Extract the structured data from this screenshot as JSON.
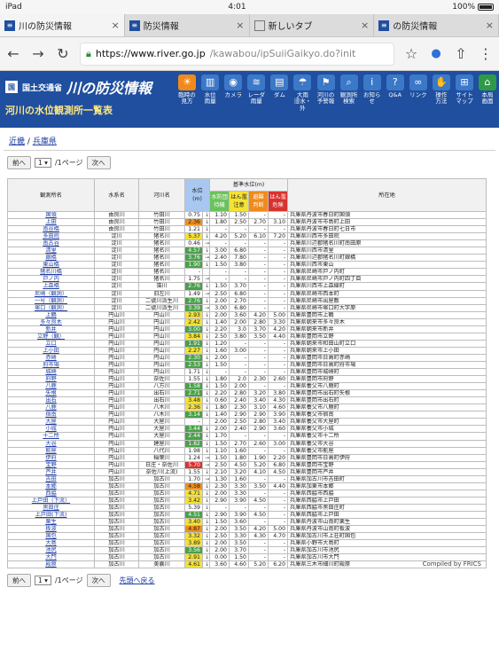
{
  "status_bar": {
    "device": "iPad",
    "time": "4:01",
    "battery": "100%"
  },
  "tabs": [
    {
      "title": "川の防災情報",
      "icon": "mlit-icon",
      "active": true
    },
    {
      "title": "防災情報",
      "icon": "mlit-icon",
      "active": false
    },
    {
      "title": "新しいタブ",
      "icon": "blank-page-icon",
      "active": false
    },
    {
      "title": "の防災情報",
      "icon": "mlit-icon",
      "active": false
    }
  ],
  "omnibox": {
    "host": "https://www.river.go.jp",
    "path": "/kawabou/ipSuiiGaikyo.do?init"
  },
  "site": {
    "agency": "国土交通省",
    "title": "川の防災情報",
    "subtitle": "河川の水位観測所一覧表",
    "nav": [
      {
        "label": "臨時の\n見方",
        "icon": "sun-icon"
      },
      {
        "label": "水位\n雨量",
        "icon": "gauge-icon"
      },
      {
        "label": "カメラ",
        "icon": "camera-icon"
      },
      {
        "label": "レーダ\n雨量",
        "icon": "radar-icon"
      },
      {
        "label": "ダム",
        "icon": "dam-icon"
      },
      {
        "label": "大雨\n浸水・\n外",
        "icon": "flood-icon"
      },
      {
        "label": "河川の\n予警報",
        "icon": "warning-icon"
      },
      {
        "label": "観測所\n検索",
        "icon": "search-icon"
      },
      {
        "label": "お知ら\nせ",
        "icon": "info-icon"
      },
      {
        "label": "Q&A",
        "icon": "question-icon"
      },
      {
        "label": "リンク",
        "icon": "link-icon"
      },
      {
        "label": "操作\n方法",
        "icon": "operation-icon"
      },
      {
        "label": "サイト\nマップ",
        "icon": "sitemap-icon"
      },
      {
        "label": "本局\n画面",
        "icon": "home-icon"
      }
    ]
  },
  "breadcrumb": {
    "region": "近畿",
    "sep": "/",
    "pref": "兵庫県"
  },
  "pager": {
    "prev": "前へ",
    "page": "1",
    "of": "/1ページ",
    "next": "次へ"
  },
  "back_link": "先頭へ戻る",
  "compiled": "Compiled by FRICS",
  "table": {
    "headers": {
      "station": "観測所名",
      "system": "水系名",
      "river": "河川名",
      "level": "水位\n(m)",
      "criteria": "基準水位(m)",
      "lv1": "水防団\n待機",
      "lv2": "はん濫\n注意",
      "lv3": "避難\n判断",
      "lv4": "はん濫\n危険",
      "location": "所在地"
    },
    "rows": [
      {
        "n": "国領",
        "s": "由良川",
        "r": "竹田川",
        "v": "0.75",
        "a": "↓",
        "c": "",
        "l1": "1.10",
        "l2": "1.50",
        "l3": "-",
        "l4": "-",
        "loc": "兵庫県丹波市春日町国領"
      },
      {
        "n": "上田",
        "s": "由良川",
        "r": "竹田川",
        "v": "2.36",
        "a": "↓",
        "c": "o",
        "l1": "1.80",
        "l2": "2.50",
        "l3": "2.70",
        "l4": "3.10",
        "loc": "兵庫県丹波市市島町上田"
      },
      {
        "n": "南谷橋",
        "s": "由良川",
        "r": "竹田川",
        "v": "1.21",
        "a": "↓",
        "c": "",
        "l1": "-",
        "l2": "-",
        "l3": "-",
        "l4": "-",
        "loc": "兵庫県丹波市春日町七日市"
      },
      {
        "n": "多田院",
        "s": "淀川",
        "r": "猪名川",
        "v": "5.37",
        "a": "↓",
        "c": "y",
        "l1": "4.20",
        "l2": "5.20",
        "l3": "6.10",
        "l4": "7.20",
        "loc": "兵庫県川西市多田院"
      },
      {
        "n": "南古谷",
        "s": "淀川",
        "r": "猪名川",
        "v": "0.46",
        "a": "→",
        "c": "",
        "l1": "-",
        "l2": "-",
        "l3": "-",
        "l4": "-",
        "loc": "兵庫県川辺郡猪名川町南田原"
      },
      {
        "n": "清里",
        "s": "淀川",
        "r": "猪名川",
        "v": "4.57",
        "a": "↓",
        "c": "g",
        "l1": "3.00",
        "l2": "6.80",
        "l3": "-",
        "l4": "-",
        "loc": "兵庫県川西市清里"
      },
      {
        "n": "銀橋",
        "s": "淀川",
        "r": "猪名川",
        "v": "3.76",
        "a": "→",
        "c": "g",
        "l1": "2.40",
        "l2": "7.80",
        "l3": "-",
        "l4": "-",
        "loc": "兵庫県川辺郡猪名川町銀橋"
      },
      {
        "name_only": true,
        "n": "東山橋",
        "s": "淀川",
        "r": "猪名川",
        "v": "1.90",
        "a": "↓",
        "c": "g",
        "l1": "1.50",
        "l2": "3.80",
        "l3": "-",
        "l4": "-",
        "loc": "兵庫県川西市東山"
      },
      {
        "n": "猪名川橋",
        "s": "淀川",
        "r": "猪名川",
        "v": "-",
        "a": "",
        "c": "",
        "l1": "-",
        "l2": "-",
        "l3": "-",
        "l4": "-",
        "loc": "兵庫県尼崎市戸ノ内町"
      },
      {
        "n": "戸ノ内",
        "s": "淀川",
        "r": "猪名川",
        "v": "1.75",
        "a": "→",
        "c": "",
        "l1": "-",
        "l2": "-",
        "l3": "-",
        "l4": "-",
        "loc": "兵庫県尼崎市戸ノ内町四丁目"
      },
      {
        "n": "上森橋",
        "s": "淀川",
        "r": "藻川",
        "v": "2.76",
        "a": "↓",
        "c": "g",
        "l1": "1.50",
        "l2": "3.70",
        "l3": "-",
        "l4": "-",
        "loc": "兵庫県川西市上森線町"
      },
      {
        "n": "尼崎（観測）",
        "s": "淀川",
        "r": "旧左川",
        "v": "1.49",
        "a": "→",
        "c": "",
        "l1": "2.50",
        "l2": "6.80",
        "l3": "-",
        "l4": "-",
        "loc": "兵庫県尼崎市西本町"
      },
      {
        "n": "一号（観測）",
        "s": "淀川",
        "r": "二號川派生川",
        "v": "2.76",
        "a": "↓",
        "c": "g",
        "l1": "2.00",
        "l2": "2.70",
        "l3": "-",
        "l4": "-",
        "loc": "兵庫県尼崎市出屋敷"
      },
      {
        "n": "塚口（観測）",
        "s": "淀川",
        "r": "二號川派生川",
        "v": "3.39",
        "a": "→",
        "c": "g",
        "l1": "3.00",
        "l2": "6.80",
        "l3": "-",
        "l4": "-",
        "loc": "兵庫県尼崎市塚口町大字原"
      },
      {
        "n": "上鶴",
        "s": "円山川",
        "r": "円山川",
        "v": "2.93",
        "a": "↓",
        "c": "y",
        "l1": "2.00",
        "l2": "3.60",
        "l3": "4.20",
        "l4": "5.00",
        "loc": "兵庫県豊岡市上鶴"
      },
      {
        "n": "多々良木",
        "s": "円山川",
        "r": "円山川",
        "v": "2.42",
        "a": "↓",
        "c": "y",
        "l1": "1.40",
        "l2": "2.00",
        "l3": "2.80",
        "l4": "3.30",
        "loc": "兵庫県朝来市多々良木"
      },
      {
        "n": "新井",
        "s": "円山川",
        "r": "円山川",
        "v": "3.00",
        "a": "↓",
        "c": "g",
        "l1": "2.20",
        "l2": "3.0",
        "l3": "3.70",
        "l4": "4.20",
        "loc": "兵庫県朝来市新井"
      },
      {
        "n": "立野（観）",
        "s": "円山川",
        "r": "円山川",
        "v": "3.84",
        "a": "↓",
        "c": "y",
        "l1": "2.50",
        "l2": "3.80",
        "l3": "3.50",
        "l4": "4.40",
        "loc": "兵庫県豊岡市立野"
      },
      {
        "n": "立口",
        "s": "円山川",
        "r": "円山川",
        "v": "1.91",
        "a": "↓",
        "c": "g",
        "l1": "1.20",
        "l2": "-",
        "l3": "-",
        "l4": "-",
        "loc": "兵庫県朝来市和田山町立口"
      },
      {
        "n": "上小田",
        "s": "円山川",
        "r": "円山川",
        "v": "2.27",
        "a": "↓",
        "c": "y",
        "l1": "1.60",
        "l2": "3.00",
        "l3": "-",
        "l4": "-",
        "loc": "兵庫県朝来市上小田"
      },
      {
        "n": "赤崎",
        "s": "円山川",
        "r": "円山川",
        "v": "2.30",
        "a": "↓",
        "c": "g",
        "l1": "2.00",
        "l2": "-",
        "l3": "-",
        "l4": "-",
        "loc": "兵庫県豊岡市日高町赤崎"
      },
      {
        "n": "府市場",
        "s": "円山川",
        "r": "円山川",
        "v": "2.53",
        "a": "↓",
        "c": "g",
        "l1": "1.50",
        "l2": "-",
        "l3": "-",
        "l4": "-",
        "loc": "兵庫県豊岡市日高町府市場"
      },
      {
        "n": "城崎",
        "s": "円山川",
        "r": "円山川",
        "v": "1.71",
        "a": "↓",
        "c": "",
        "l1": "-",
        "l2": "-",
        "l3": "-",
        "l4": "-",
        "loc": "兵庫県豊岡市城崎町"
      },
      {
        "n": "府野",
        "s": "円山川",
        "r": "奈佐川",
        "v": "1.55",
        "a": "↓",
        "c": "",
        "l1": "1.80",
        "l2": "2.0",
        "l3": "2.30",
        "l4": "2.60",
        "loc": "兵庫県豊岡市府野"
      },
      {
        "n": "八鹿",
        "s": "円山川",
        "r": "八方川",
        "v": "1.58",
        "a": "↓",
        "c": "g",
        "l1": "1.50",
        "l2": "2.00",
        "l3": "-",
        "l4": "-",
        "loc": "兵庫県養父市八鹿町"
      },
      {
        "n": "矢根",
        "s": "円山川",
        "r": "出石川",
        "v": "2.71",
        "a": "↓",
        "c": "g",
        "l1": "2.20",
        "l2": "2.80",
        "l3": "3.20",
        "l4": "3.80",
        "loc": "兵庫県豊岡市出石町矢根"
      },
      {
        "n": "出石",
        "s": "円山川",
        "r": "出石川",
        "v": "3.48",
        "a": "↓",
        "c": "y",
        "l1": "0.60",
        "l2": "2.40",
        "l3": "3.40",
        "l4": "4.30",
        "loc": "兵庫県豊岡市出石町"
      },
      {
        "n": "八鹿",
        "s": "円山川",
        "r": "八木川",
        "v": "2.36",
        "a": "↓",
        "c": "y",
        "l1": "1.80",
        "l2": "2.30",
        "l3": "3.10",
        "l4": "4.60",
        "loc": "兵庫県養父市八鹿町"
      },
      {
        "n": "宿南",
        "s": "円山川",
        "r": "八木川",
        "v": "3.14",
        "a": "↓",
        "c": "g",
        "l1": "1.40",
        "l2": "2.90",
        "l3": "2.90",
        "l4": "3.90",
        "loc": "兵庫県養父市宿南"
      },
      {
        "n": "大屋",
        "s": "円山川",
        "r": "大屋川",
        "v": "-",
        "a": "",
        "c": "",
        "l1": "2.00",
        "l2": "2.50",
        "l3": "2.80",
        "l4": "3.40",
        "loc": "兵庫県養父市大屋町"
      },
      {
        "n": "小城",
        "s": "円山川",
        "r": "大屋川",
        "v": "3.44",
        "a": "↓",
        "c": "g",
        "l1": "2.00",
        "l2": "2.40",
        "l3": "2.90",
        "l4": "3.60",
        "loc": "兵庫県養父市小城"
      },
      {
        "n": "十二所",
        "s": "円山川",
        "r": "大屋川",
        "v": "2.44",
        "a": "↓",
        "c": "g",
        "l1": "1.70",
        "l2": "-",
        "l3": "-",
        "l4": "-",
        "loc": "兵庫県養父市十二所"
      },
      {
        "n": "大谷",
        "s": "円山川",
        "r": "建屋川",
        "v": "1.82",
        "a": "↓",
        "c": "g",
        "l1": "1.50",
        "l2": "2.70",
        "l3": "2.60",
        "l4": "3.00",
        "loc": "兵庫県養父市大谷"
      },
      {
        "n": "能座",
        "s": "円山川",
        "r": "八代川",
        "v": "1.98",
        "a": "↓",
        "c": "",
        "l1": "1.10",
        "l2": "1.60",
        "l3": "-",
        "l4": "-",
        "loc": "兵庫県養父市能座"
      },
      {
        "n": "伊府",
        "s": "円山川",
        "r": "稲葉川",
        "v": "1.24",
        "a": "→",
        "c": "",
        "l1": "1.50",
        "l2": "1.80",
        "l3": "1.90",
        "l4": "2.20",
        "loc": "兵庫県豊岡市日高町伊府"
      },
      {
        "n": "宝野",
        "s": "円山川",
        "r": "日庄・奈佐川",
        "v": "5.70",
        "a": "→",
        "c": "red",
        "l1": "2.50",
        "l2": "4.50",
        "l3": "5.20",
        "l4": "6.80",
        "loc": "兵庫県豊岡市宝野"
      },
      {
        "n": "芦井",
        "s": "円山川",
        "r": "奈佐川(上流)",
        "v": "1.55",
        "a": "↓",
        "c": "",
        "l1": "2.10",
        "l2": "3.20",
        "l3": "4.10",
        "l4": "4.50",
        "loc": "兵庫県豊岡市芦井"
      },
      {
        "n": "吉田",
        "s": "加古川",
        "r": "加古川",
        "v": "1.70",
        "a": "→",
        "c": "",
        "l1": "1.30",
        "l2": "1.60",
        "l3": "-",
        "l4": "-",
        "loc": "兵庫県加古川市吉田町"
      },
      {
        "n": "本郷",
        "s": "加古川",
        "r": "加古川",
        "v": "4.58",
        "a": "↓",
        "c": "o",
        "l1": "2.30",
        "l2": "3.30",
        "l3": "3.50",
        "l4": "4.40",
        "loc": "兵庫県加東市本郷"
      },
      {
        "n": "西脇",
        "s": "加古川",
        "r": "加古川",
        "v": "4.71",
        "a": "↓",
        "c": "y",
        "l1": "2.00",
        "l2": "3.30",
        "l3": "-",
        "l4": "-",
        "loc": "兵庫県西脇市西脇"
      },
      {
        "n": "上戸田（下流）",
        "s": "加古川",
        "r": "加古川",
        "v": "3.42",
        "a": "↓",
        "c": "y",
        "l1": "2.90",
        "l2": "3.90",
        "l3": "4.50",
        "l4": "-",
        "loc": "兵庫県西脇市上戸田"
      },
      {
        "n": "黒田庄",
        "s": "加古川",
        "r": "加古川",
        "v": "5.39",
        "a": "↓",
        "c": "",
        "l1": "-",
        "l2": "-",
        "l3": "-",
        "l4": "-",
        "loc": "兵庫県西脇市黒田庄町"
      },
      {
        "n": "上戸田(下流)",
        "s": "加古川",
        "r": "加古川",
        "v": "4.51",
        "a": "↓",
        "c": "g",
        "l1": "2.90",
        "l2": "3.90",
        "l3": "4.50",
        "l4": "-",
        "loc": "兵庫県西脇市上戸田"
      },
      {
        "n": "栗生",
        "s": "加古川",
        "r": "加古川",
        "v": "3.40",
        "a": "↓",
        "c": "y",
        "l1": "1.50",
        "l2": "3.60",
        "l3": "-",
        "l4": "-",
        "loc": "兵庫県丹波市山南町栗生"
      },
      {
        "n": "板波",
        "s": "加古川",
        "r": "加古川",
        "v": "4.87",
        "a": "↓",
        "c": "o",
        "l1": "2.00",
        "l2": "3.50",
        "l3": "4.20",
        "l4": "5.00",
        "loc": "兵庫県丹波市山南町板波"
      },
      {
        "n": "国包",
        "s": "加古川",
        "r": "加古川",
        "v": "3.32",
        "a": "↓",
        "c": "y",
        "l1": "2.50",
        "l2": "3.30",
        "l3": "4.30",
        "l4": "4.70",
        "loc": "兵庫県加古川市上荘町国包"
      },
      {
        "n": "大島",
        "s": "加古川",
        "r": "加古川",
        "v": "3.89",
        "a": "↓",
        "c": "y",
        "l1": "2.00",
        "l2": "3.50",
        "l3": "-",
        "l4": "-",
        "loc": "兵庫県小野市大島町"
      },
      {
        "n": "池尻",
        "s": "加古川",
        "r": "加古川",
        "v": "3.56",
        "a": "↓",
        "c": "g",
        "l1": "2.00",
        "l2": "3.70",
        "l3": "-",
        "l4": "-",
        "loc": "兵庫県加古川市池尻"
      },
      {
        "n": "大門",
        "s": "加古川",
        "r": "加古川",
        "v": "2.91",
        "a": "↓",
        "c": "y",
        "l1": "0.00",
        "l2": "1.50",
        "l3": "-",
        "l4": "-",
        "loc": "兵庫県加古川市大門"
      },
      {
        "n": "殿原",
        "s": "加古川",
        "r": "美嚢川",
        "v": "4.61",
        "a": "↓",
        "c": "y",
        "l1": "3.60",
        "l2": "4.60",
        "l3": "5.20",
        "l4": "6.20",
        "loc": "兵庫県三木市細川町殿原"
      }
    ]
  }
}
